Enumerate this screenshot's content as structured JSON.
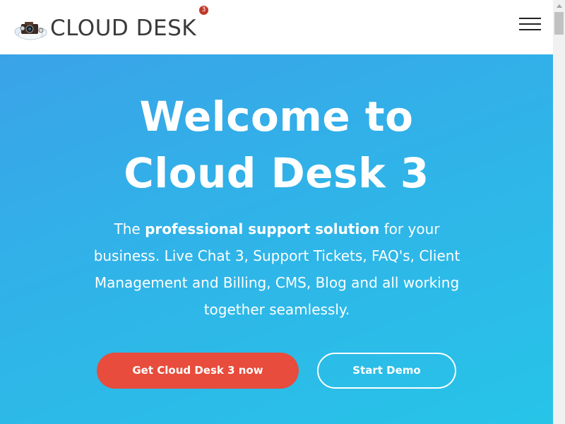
{
  "header": {
    "logo_text": "CLOUD DESK",
    "logo_badge": "3",
    "menu_icon": "hamburger-menu-icon"
  },
  "hero": {
    "title_line1": "Welcome to",
    "title_line2": "Cloud Desk 3",
    "desc_prefix": "The ",
    "desc_bold": "professional support solution",
    "desc_rest": " for your business. Live Chat 3, Support Tickets, FAQ's, Client Management and Billing, CMS, Blog and all working together seamlessly.",
    "primary_button": "Get Cloud Desk 3 now",
    "secondary_button": "Start Demo"
  },
  "colors": {
    "hero_gradient_start": "#3aa3e8",
    "hero_gradient_end": "#27c4e8",
    "primary_button": "#e74c3c",
    "logo_badge": "#c0392b"
  }
}
